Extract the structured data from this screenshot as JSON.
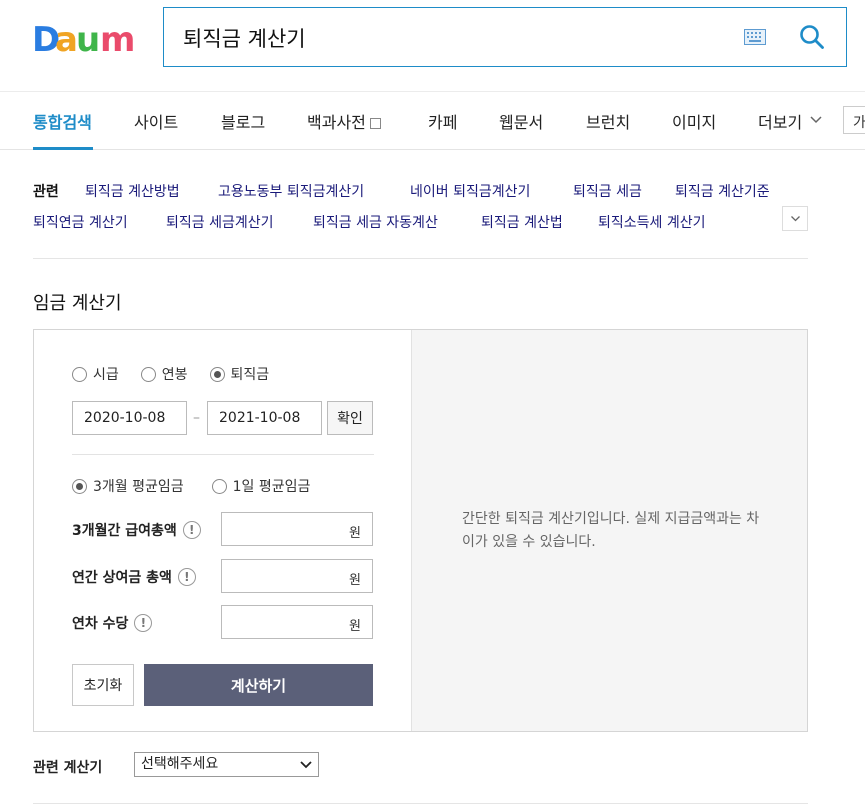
{
  "logo": {
    "text": "Daum"
  },
  "search": {
    "query": "퇴직금 계산기"
  },
  "tabs": [
    {
      "label": "통합검색",
      "active": true
    },
    {
      "label": "사이트"
    },
    {
      "label": "블로그"
    },
    {
      "label": "백과사전"
    },
    {
      "label": "카페"
    },
    {
      "label": "웹문서"
    },
    {
      "label": "브런치"
    },
    {
      "label": "이미지"
    },
    {
      "label": "더보기"
    }
  ],
  "tab_extra": "가",
  "related": {
    "heading": "관련",
    "links": [
      "퇴직금 계산방법",
      "고용노동부 퇴직금계산기",
      "네이버 퇴직금계산기",
      "퇴직금 세금",
      "퇴직금 계산기준",
      "퇴직연금 계산기",
      "퇴직금 세금계산기",
      "퇴직금 세금 자동계산",
      "퇴직금 계산법",
      "퇴직소득세 계산기"
    ]
  },
  "calculator": {
    "title": "임금 계산기",
    "type_options": [
      {
        "label": "시급",
        "selected": false
      },
      {
        "label": "연봉",
        "selected": false
      },
      {
        "label": "퇴직금",
        "selected": true
      }
    ],
    "start_date": "2020-10-08",
    "end_date": "2021-10-08",
    "date_separator": "–",
    "confirm_label": "확인",
    "basis_options": [
      {
        "label": "3개월 평균임금",
        "selected": true
      },
      {
        "label": "1일 평균임금",
        "selected": false
      }
    ],
    "fields": [
      {
        "label": "3개월간 급여총액",
        "unit": "원",
        "value": ""
      },
      {
        "label": "연간 상여금 총액",
        "unit": "원",
        "value": ""
      },
      {
        "label": "연차 수당",
        "unit": "원",
        "value": ""
      }
    ],
    "help_symbol": "!",
    "reset_label": "초기화",
    "submit_label": "계산하기",
    "notice": "간단한 퇴직금 계산기입니다. 실제 지급금액과는 차이가 있을 수 있습니다."
  },
  "related_calculators": {
    "label": "관련 계산기",
    "selected": "선택해주세요"
  },
  "colors": {
    "accent": "#1e8cc8",
    "button": "#5b6079",
    "panel_bg": "#f5f5f5"
  }
}
